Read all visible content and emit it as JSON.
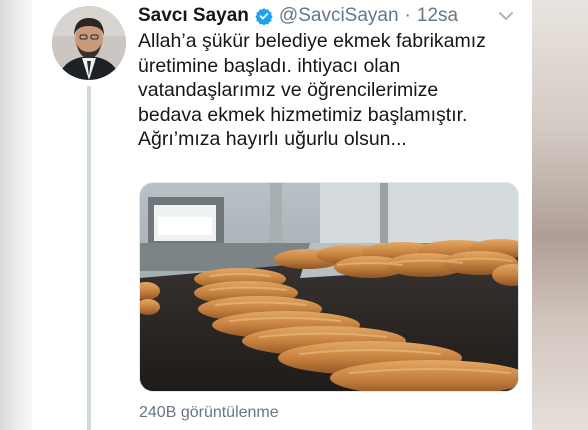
{
  "tweet": {
    "author_name": "Savcı Sayan",
    "handle": "@SavciSayan",
    "separator": "·",
    "time": "12sa",
    "verified": true,
    "text_lines": [
      "Allah’a şükür belediye ekmek fabrikamız",
      "üretimine başladı. ihtiyacı olan",
      "vatandaşlarımız ve  öğrencilerimize",
      "bedava ekmek hizmetimiz başlamıştır.",
      "Ağrı’mıza hayırlı uğurlu olsun..."
    ],
    "views": "240B görüntülenme"
  },
  "icons": {
    "verified": "verified-badge-icon",
    "more": "chevron-down-icon"
  },
  "colors": {
    "verified_blue": "#1da1f2",
    "secondary_text": "#657786",
    "primary_text": "#14171a",
    "thread_line": "#cfd9de"
  }
}
